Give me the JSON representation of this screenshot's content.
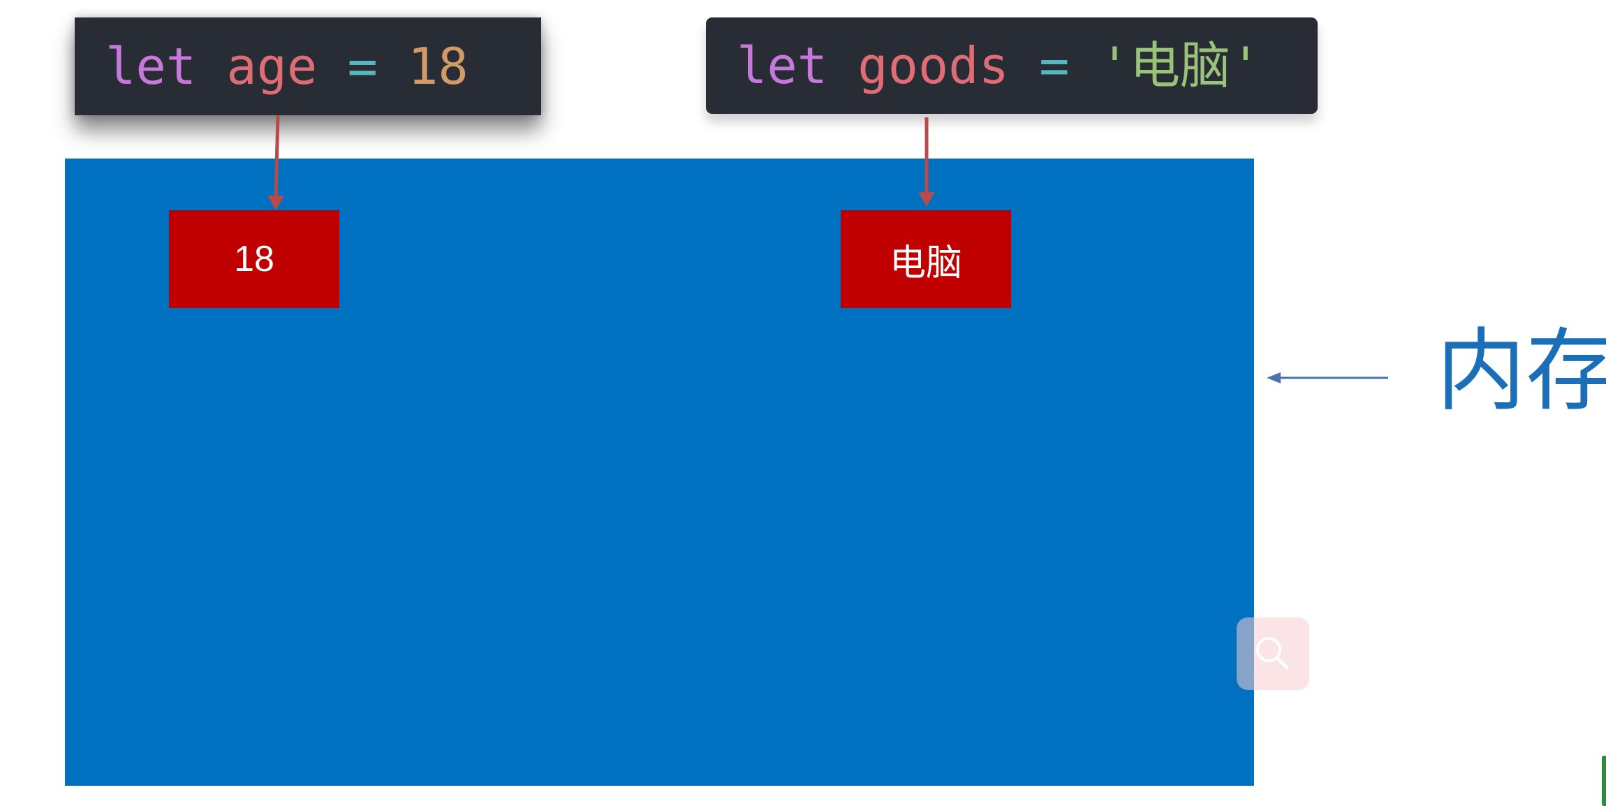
{
  "code_snippets": {
    "age": {
      "keyword": "let",
      "name": "age",
      "operator": "=",
      "value": "18"
    },
    "goods": {
      "keyword": "let",
      "name": "goods",
      "operator": "=",
      "value": "'电脑'"
    }
  },
  "memory": {
    "cells": {
      "age": "18",
      "goods": "电脑"
    },
    "label": "内存"
  },
  "colors": {
    "code_background": "#282c34",
    "keyword": "#c678dd",
    "variable": "#e06c75",
    "operator": "#56b6c2",
    "number": "#d19a66",
    "string": "#98c379",
    "memory_panel": "#0070c0",
    "value_cell": "#c00000",
    "arrow": "#b94a4a",
    "label": "#1a6fb8"
  },
  "icons": {
    "search": "search-icon"
  }
}
